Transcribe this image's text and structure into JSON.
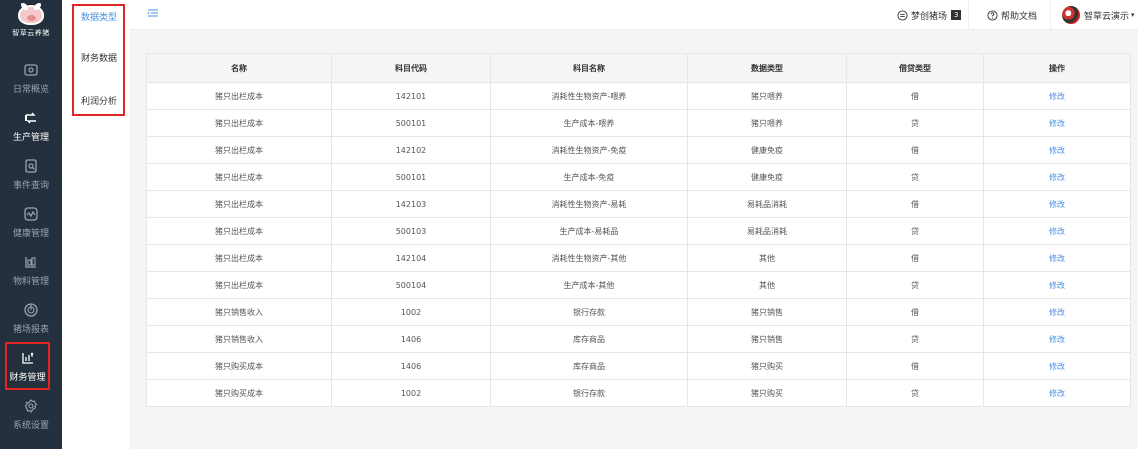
{
  "logo": {
    "text": "智草云养猪"
  },
  "sidebar": {
    "items": [
      {
        "label": "日常概览",
        "icon": "dashboard-icon"
      },
      {
        "label": "生产管理",
        "icon": "production-icon"
      },
      {
        "label": "事件查询",
        "icon": "event-query-icon"
      },
      {
        "label": "健康管理",
        "icon": "health-icon"
      },
      {
        "label": "物料管理",
        "icon": "material-icon"
      },
      {
        "label": "猪场报表",
        "icon": "report-icon"
      },
      {
        "label": "财务管理",
        "icon": "finance-icon"
      },
      {
        "label": "系统设置",
        "icon": "settings-icon"
      }
    ]
  },
  "submenu": {
    "items": [
      {
        "label": "数据类型"
      },
      {
        "label": "财务数据"
      },
      {
        "label": "利润分析"
      }
    ]
  },
  "topbar": {
    "farm": "梦创猪场",
    "farm_badge": "3",
    "help": "帮助文档",
    "user": "智草云演示"
  },
  "table": {
    "headers": [
      "名称",
      "科目代码",
      "科目名称",
      "数据类型",
      "借贷类型",
      "操作"
    ],
    "rows": [
      [
        "猪只出栏成本",
        "142101",
        "消耗性生物资产-喂养",
        "猪只喂养",
        "借",
        "修改"
      ],
      [
        "猪只出栏成本",
        "500101",
        "生产成本-喂养",
        "猪只喂养",
        "贷",
        "修改"
      ],
      [
        "猪只出栏成本",
        "142102",
        "消耗性生物资产-免疫",
        "健康免疫",
        "借",
        "修改"
      ],
      [
        "猪只出栏成本",
        "500101",
        "生产成本-免疫",
        "健康免疫",
        "贷",
        "修改"
      ],
      [
        "猪只出栏成本",
        "142103",
        "消耗性生物资产-易耗",
        "易耗品消耗",
        "借",
        "修改"
      ],
      [
        "猪只出栏成本",
        "500103",
        "生产成本-易耗品",
        "易耗品消耗",
        "贷",
        "修改"
      ],
      [
        "猪只出栏成本",
        "142104",
        "消耗性生物资产-其他",
        "其他",
        "借",
        "修改"
      ],
      [
        "猪只出栏成本",
        "500104",
        "生产成本-其他",
        "其他",
        "贷",
        "修改"
      ],
      [
        "猪只销售收入",
        "1002",
        "银行存款",
        "猪只销售",
        "借",
        "修改"
      ],
      [
        "猪只销售收入",
        "1406",
        "库存商品",
        "猪只销售",
        "贷",
        "修改"
      ],
      [
        "猪只购买成本",
        "1406",
        "库存商品",
        "猪只购买",
        "借",
        "修改"
      ],
      [
        "猪只购买成本",
        "1002",
        "银行存款",
        "猪只购买",
        "贷",
        "修改"
      ]
    ]
  },
  "colors": {
    "sidebar_bg": "#25303f",
    "link": "#4a90e2",
    "highlight_box": "#e02424"
  }
}
